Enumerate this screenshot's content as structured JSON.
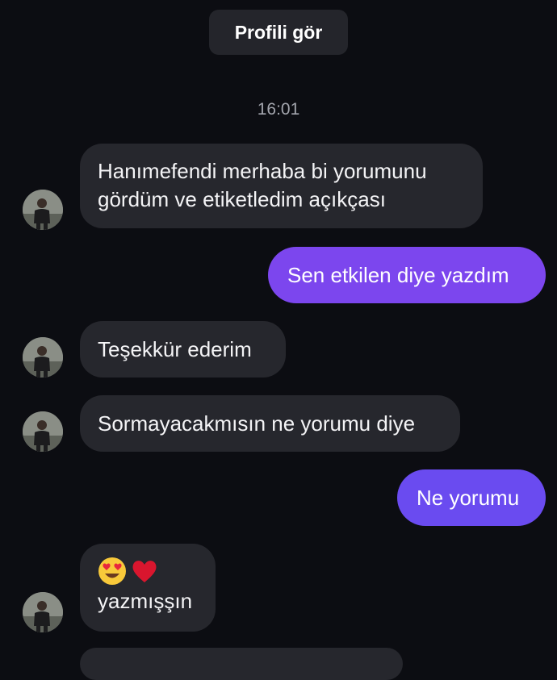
{
  "header": {
    "profile_button_label": "Profili gör"
  },
  "conversation": {
    "timestamp": "16:01",
    "messages": [
      {
        "direction": "incoming",
        "lines": [
          "Hanımefendi merhaba bi yorumunu",
          "gördüm ve etiketledim açıkçası"
        ]
      },
      {
        "direction": "outgoing",
        "text": "Sen etkilen diye yazdım"
      },
      {
        "direction": "incoming",
        "text": "Teşekkür ederim"
      },
      {
        "direction": "incoming",
        "text": "Sormayacakmısın ne yorumu diye"
      },
      {
        "direction": "outgoing",
        "text": "Ne yorumu"
      },
      {
        "direction": "incoming",
        "emojis": [
          "heart-eyes-emoji",
          "red-heart-emoji"
        ],
        "text": "yazmışşın"
      }
    ]
  },
  "colors": {
    "background": "#0c0d12",
    "incoming_bubble": "#26272d",
    "outgoing_bubble_a": "#7c46ee",
    "outgoing_bubble_b": "#6a4bf0"
  }
}
